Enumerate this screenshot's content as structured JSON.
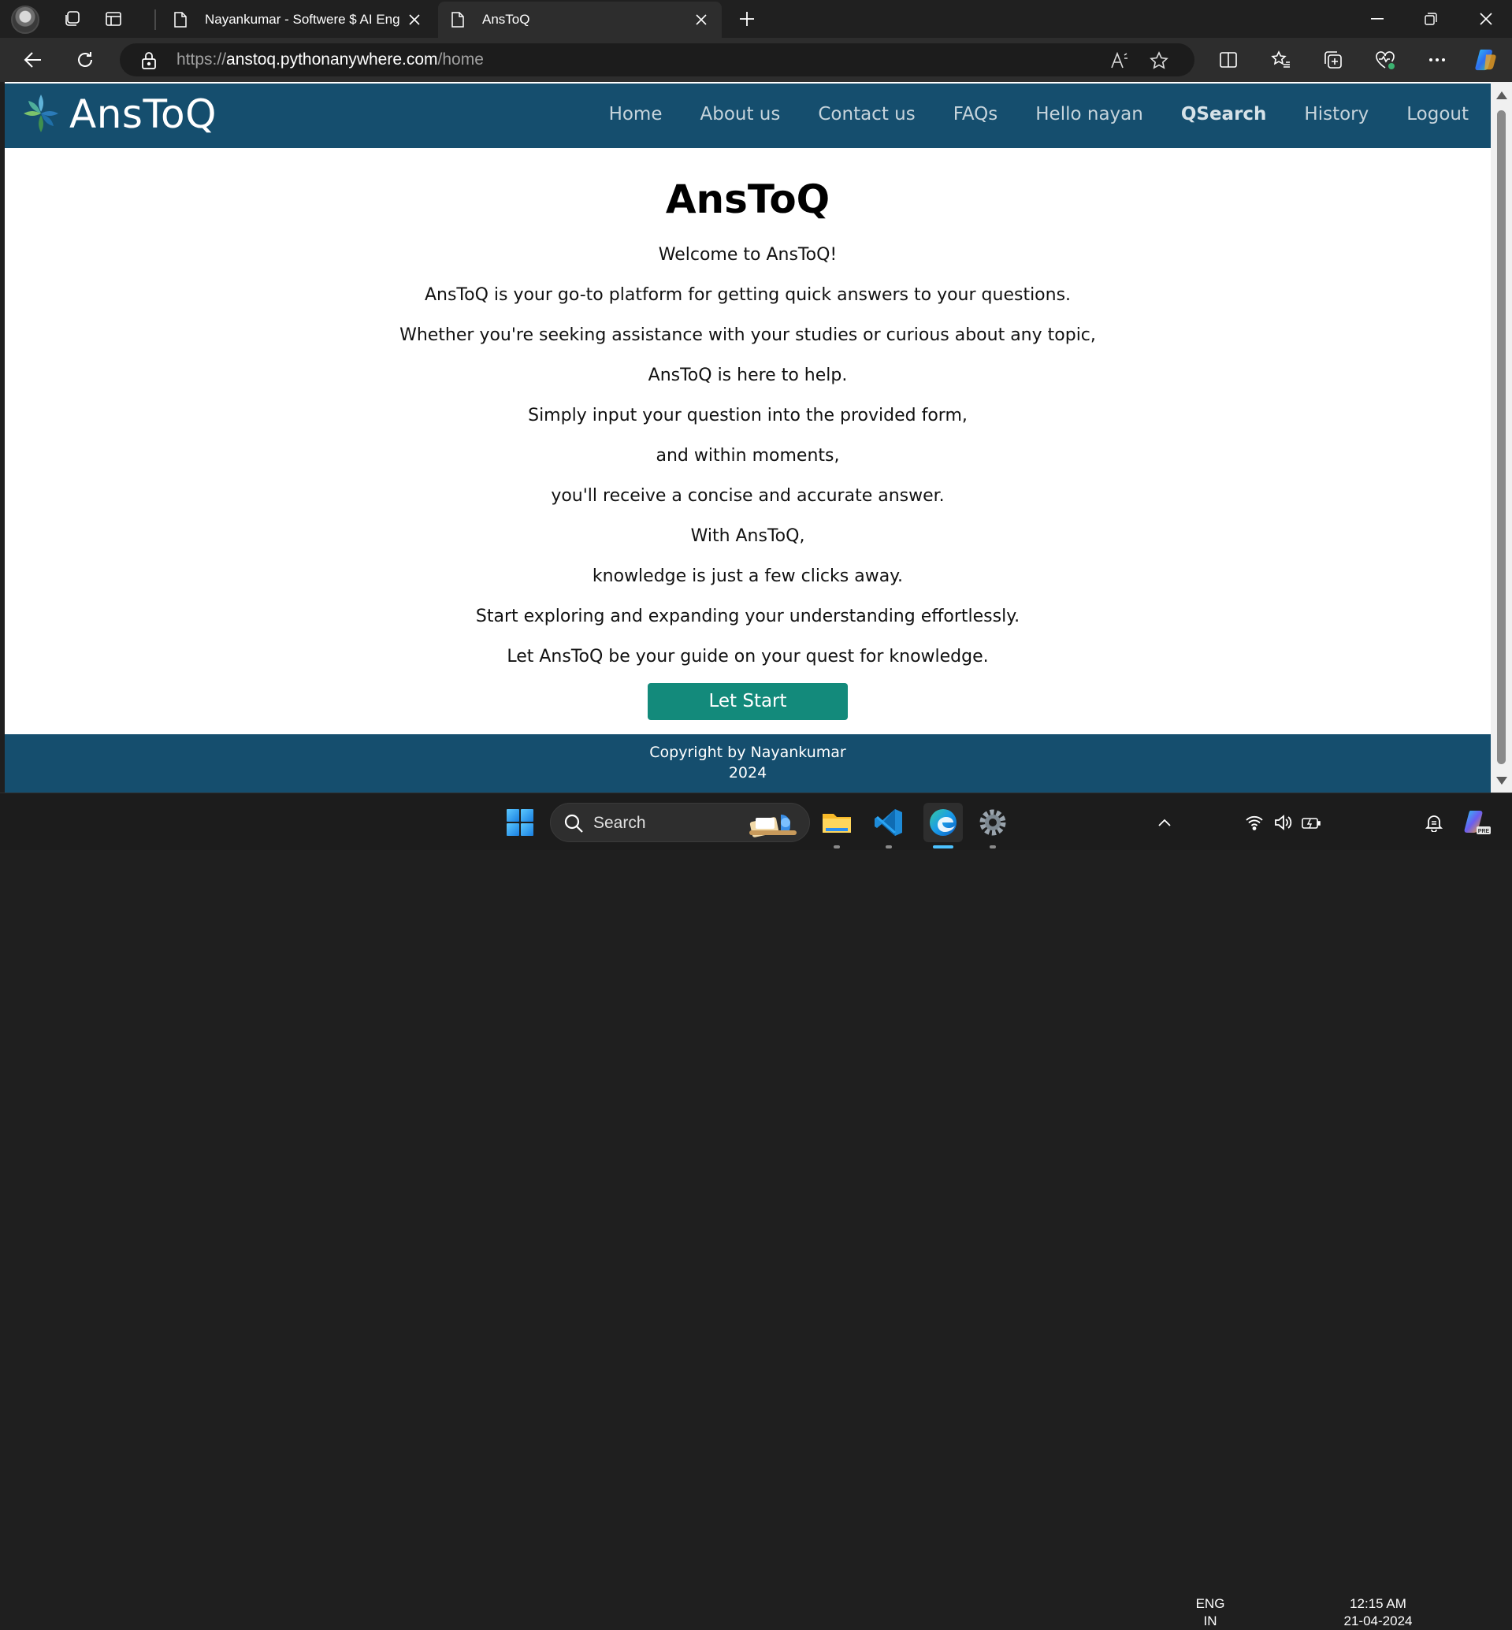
{
  "browser": {
    "tabs": [
      {
        "title": "Nayankumar - Softwere $ AI Eng",
        "active": false
      },
      {
        "title": "AnsToQ",
        "active": true
      }
    ],
    "url": {
      "scheme": "https://",
      "host": "anstoq.pythonanywhere.com",
      "path": "/home"
    }
  },
  "site": {
    "brand": "AnsToQ",
    "nav": [
      {
        "label": "Home",
        "bold": false
      },
      {
        "label": "About us",
        "bold": false
      },
      {
        "label": "Contact us",
        "bold": false
      },
      {
        "label": "FAQs",
        "bold": false
      },
      {
        "label": "Hello nayan",
        "bold": false
      },
      {
        "label": "QSearch",
        "bold": true
      },
      {
        "label": "History",
        "bold": false
      },
      {
        "label": "Logout",
        "bold": false
      }
    ],
    "title": "AnsToQ",
    "paragraphs": [
      "Welcome to AnsToQ!",
      "AnsToQ is your go-to platform for getting quick answers to your questions.",
      "Whether you're seeking assistance with your studies or curious about any topic,",
      "AnsToQ is here to help.",
      "Simply input your question into the provided form,",
      "and within moments,",
      "you'll receive a concise and accurate answer.",
      "With AnsToQ,",
      "knowledge is just a few clicks away.",
      "Start exploring and expanding your understanding effortlessly.",
      "Let AnsToQ be your guide on your quest for knowledge."
    ],
    "cta_label": "Let Start",
    "footer": {
      "line1": "Copyright by Nayankumar",
      "line2": "2024"
    }
  },
  "taskbar": {
    "search_label": "Search",
    "language": {
      "line1": "ENG",
      "line2": "IN"
    },
    "clock": {
      "time": "12:15 AM",
      "date": "21-04-2024"
    }
  },
  "colors": {
    "navbar": "#154e6e",
    "cta": "#138a7b",
    "chrome_dark": "#202020"
  }
}
